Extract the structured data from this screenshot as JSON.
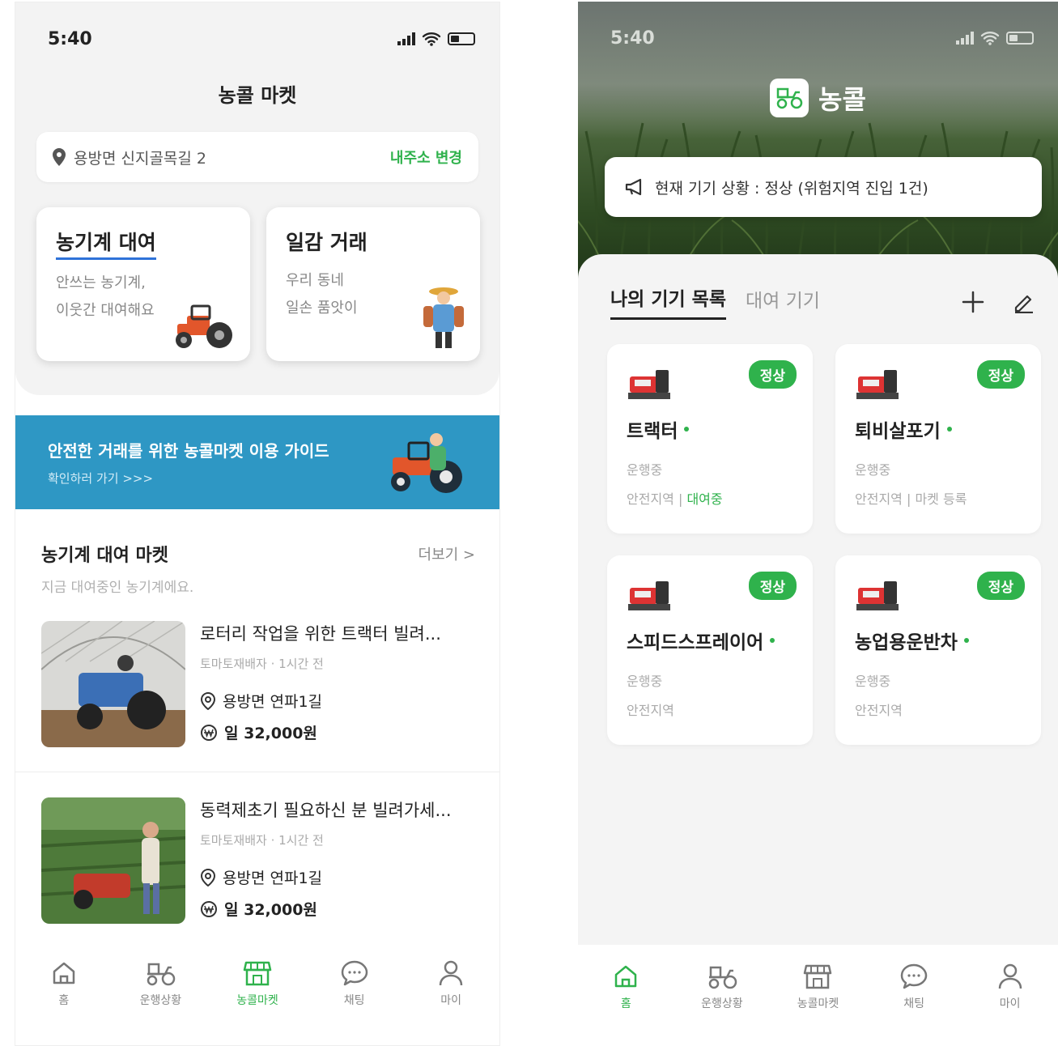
{
  "status_bar": {
    "time": "5:40"
  },
  "left_screen": {
    "title": "농콜 마켓",
    "address": {
      "text": "용방면 신지골목길 2",
      "change_label": "내주소 변경"
    },
    "service_cards": [
      {
        "title": "농기계 대여",
        "line1": "안쓰는 농기계,",
        "line2": "이웃간 대여해요"
      },
      {
        "title": "일감 거래",
        "line1": "우리 동네",
        "line2": "일손 품앗이"
      }
    ],
    "banner": {
      "title": "안전한 거래를 위한 농콜마켓 이용 가이드",
      "subtitle": "확인하러 가기 >>>"
    },
    "market_section": {
      "title": "농기계 대여 마켓",
      "more_label": "더보기 >",
      "subtitle": "지금 대여중인 농기계에요."
    },
    "listings": [
      {
        "title": "로터리 작업을 위한 트랙터 빌려...",
        "meta": "토마토재배자 · 1시간 전",
        "location": "용방면 연파1길",
        "price": "일 32,000원"
      },
      {
        "title": "동력제초기 필요하신 분 빌려가세...",
        "meta": "토마토재배자 · 1시간 전",
        "location": "용방면 연파1길",
        "price": "일 32,000원"
      }
    ]
  },
  "right_screen": {
    "brand": "농콜",
    "notice": "현재 기기 상황 : 정상 (위험지역 진입 1건)",
    "tabs": {
      "my_devices": "나의 기기 목록",
      "rental_devices": "대여 기기"
    },
    "devices": [
      {
        "name": "트랙터",
        "badge": "정상",
        "status": "운행중",
        "zone": "안전지역 | ",
        "zone_extra": "대여중"
      },
      {
        "name": "퇴비살포기",
        "badge": "정상",
        "status": "운행중",
        "zone": "안전지역 | 마켓 등록",
        "zone_extra": ""
      },
      {
        "name": "스피드스프레이어",
        "badge": "정상",
        "status": "운행중",
        "zone": "안전지역",
        "zone_extra": ""
      },
      {
        "name": "농업용운반차",
        "badge": "정상",
        "status": "운행중",
        "zone": "안전지역",
        "zone_extra": ""
      }
    ]
  },
  "tabbar": {
    "items": [
      {
        "label": "홈",
        "icon": "home-icon"
      },
      {
        "label": "운행상황",
        "icon": "tractor-icon"
      },
      {
        "label": "농콜마켓",
        "icon": "store-icon"
      },
      {
        "label": "채팅",
        "icon": "chat-icon"
      },
      {
        "label": "마이",
        "icon": "person-icon"
      }
    ],
    "left_active": "농콜마켓",
    "right_active": "홈"
  },
  "colors": {
    "accent_green": "#2fb24c",
    "banner_blue": "#2e97c4",
    "underline_blue": "#2f73d9"
  }
}
